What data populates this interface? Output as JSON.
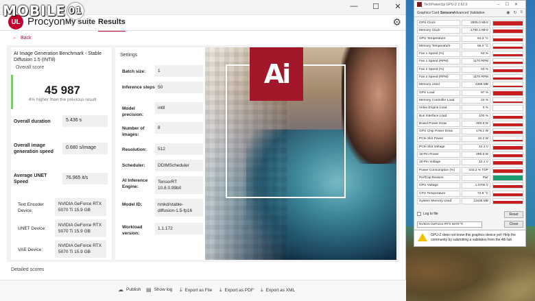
{
  "watermark": {
    "text": "MOBILE",
    "badge": "01"
  },
  "window": {
    "controls": [
      "—",
      "☐",
      "✕"
    ],
    "logo": "UL",
    "app_name": "Procyon",
    "nav": {
      "my_suite": "My suite",
      "results": "Results"
    },
    "back": "Back"
  },
  "result": {
    "benchmark_title": "AI Image Generation Benchmark - Stable Diffusion 1.5 (INT8)",
    "overall_score_label": "Overall score",
    "score": "45 987",
    "score_note": "4% higher than the previous result",
    "metrics": [
      {
        "label": "Overall duration",
        "value": "5.436 s"
      },
      {
        "label": "Overall image generation speed",
        "value": "0.680 s/image"
      },
      {
        "label": "Average UNET Speed",
        "value": "76.965 it/s"
      }
    ],
    "devices": [
      {
        "label": "Text Encoder Device:",
        "value": "NVIDIA GeForce RTX 5070 Ti 15.9 GB"
      },
      {
        "label": "UNET Device:",
        "value": "NVIDIA GeForce RTX 5070 Ti 15.9 GB"
      },
      {
        "label": "VAE Device:",
        "value": "NVIDIA GeForce RTX 5070 Ti 15.9 GB"
      }
    ]
  },
  "settings": {
    "title": "Settings",
    "items": [
      {
        "label": "Batch size:",
        "value": "1"
      },
      {
        "label": "Inference steps:",
        "value": "50"
      },
      {
        "label": "Model precision:",
        "value": "int8"
      },
      {
        "label": "Number of images:",
        "value": "8"
      },
      {
        "label": "Resolution:",
        "value": "512"
      },
      {
        "label": "Scheduler:",
        "value": "DDIMScheduler"
      },
      {
        "label": "AI Inference Engine:",
        "value": "TensorRT 10.8.0.99b0"
      },
      {
        "label": "Model ID:",
        "value": "nmkd/stable-diffusion-1.5-fp16"
      },
      {
        "label": "Workload version:",
        "value": "1.1.172"
      }
    ]
  },
  "artwork": {
    "logo_text": "Ai"
  },
  "detailed_scores": "Detailed scores",
  "actions": {
    "publish": "Publish",
    "show_log": "Show log",
    "export_file": "Export as File",
    "export_pdf": "Export as PDF",
    "export_xml": "Export as XML"
  },
  "gpuz": {
    "title": "TechPowerUp GPU-Z 2.62.0",
    "tabs": [
      "Graphics Card",
      "Sensors",
      "Advanced",
      "Validation"
    ],
    "sensors": [
      {
        "label": "GPU Clock",
        "value": "2805.0 MHz",
        "level": 0.8
      },
      {
        "label": "Memory Clock",
        "value": "1750.1 MHz",
        "level": 0.75
      },
      {
        "label": "GPU Temperature",
        "value": "64.3 °C",
        "level": 0.55
      },
      {
        "label": "Memory Temperature",
        "value": "56.0 °C",
        "level": 0.45
      },
      {
        "label": "Fan 1 Speed (%)",
        "value": "53 %",
        "level": 0.5
      },
      {
        "label": "Fan 1 Speed (RPM)",
        "value": "1170 RPM",
        "level": 0.5
      },
      {
        "label": "Fan 2 Speed (%)",
        "value": "53 %",
        "level": 0.5
      },
      {
        "label": "Fan 2 Speed (RPM)",
        "value": "1175 RPM",
        "level": 0.5
      },
      {
        "label": "Memory Used",
        "value": "4265 MB",
        "level": 0.3
      },
      {
        "label": "GPU Load",
        "value": "97 %",
        "level": 0.85
      },
      {
        "label": "Memory Controller Load",
        "value": "24 %",
        "level": 0.25
      },
      {
        "label": "Video Engine Load",
        "value": "0 %",
        "level": 0.0
      },
      {
        "label": "Bus Interface Load",
        "value": "100 %",
        "level": 0.5
      },
      {
        "label": "Board Power Draw",
        "value": "309.8 W",
        "level": 0.6
      },
      {
        "label": "GPU Chip Power Draw",
        "value": "178.1 W",
        "level": 0.55
      },
      {
        "label": "PCIe Slot Power",
        "value": "10.2 W",
        "level": 0.4
      },
      {
        "label": "PCIe Slot Voltage",
        "value": "12.1 V",
        "level": 0.7
      },
      {
        "label": "16-Pin Power",
        "value": "299.6 W",
        "level": 0.6
      },
      {
        "label": "16-Pin Voltage",
        "value": "12.1 V",
        "level": 0.7
      },
      {
        "label": "Power Consumption (%)",
        "value": "103.2 % TDP",
        "level": 0.6
      },
      {
        "label": "PerfCap Reason",
        "value": "Pwr",
        "level": 1.0
      },
      {
        "label": "GPU Voltage",
        "value": "1.0700 V",
        "level": 0.65
      },
      {
        "label": "CPU Temperature",
        "value": "72.8 °C",
        "level": 0.55
      },
      {
        "label": "System Memory Used",
        "value": "11636 MB",
        "level": 0.5
      }
    ],
    "log_to_file": "Log to file",
    "reset": "Reset",
    "device": "NVIDIA GeForce RTX 5070 Ti",
    "close": "Close",
    "notice": "GPU-Z does not know this graphics device yet! Help the community by submitting a validation from the 4th tab"
  },
  "colors": {
    "accent": "#c2002f",
    "score_bar": "#7cc96e",
    "graph": "#c61e1e",
    "perfcap": "#1a9a70"
  }
}
